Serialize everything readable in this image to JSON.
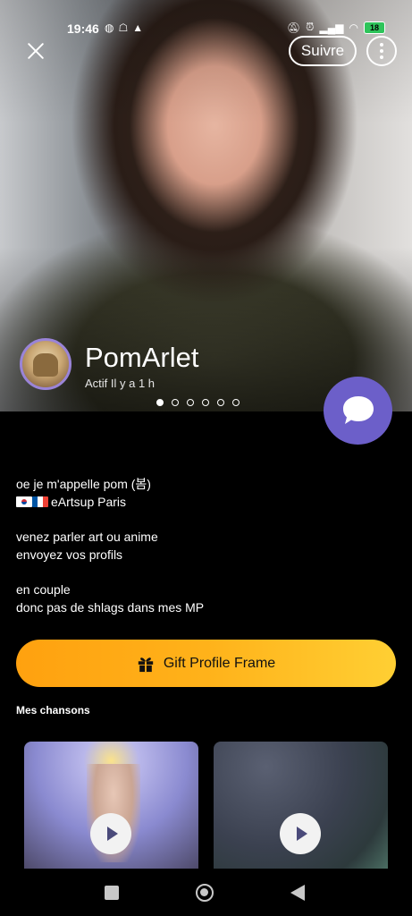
{
  "status_bar": {
    "time": "19:46",
    "left_icons": [
      "messenger-icon",
      "snapchat-icon",
      "warning-icon"
    ],
    "right_icons": [
      "mute-icon",
      "alarm-icon",
      "signal-icon",
      "wifi-icon"
    ],
    "battery": "18"
  },
  "header": {
    "follow_label": "Suivre"
  },
  "profile": {
    "username": "PomArlet",
    "last_active": "Actif Il y a 1 h",
    "photo_count": 6,
    "current_photo": 1
  },
  "bio": {
    "lines": [
      "oe je m'appelle pom (봄)",
      "eArtsup Paris",
      "venez parler art ou anime",
      "envoyez vos profils",
      "en couple",
      "donc pas de shlags dans mes MP"
    ]
  },
  "gift_button": {
    "label": "Gift Profile Frame"
  },
  "songs_section": {
    "title": "Mes chansons"
  },
  "colors": {
    "accent": "#6c5fc9",
    "gift_gradient_start": "#ffa10f",
    "gift_gradient_end": "#ffcf33"
  }
}
